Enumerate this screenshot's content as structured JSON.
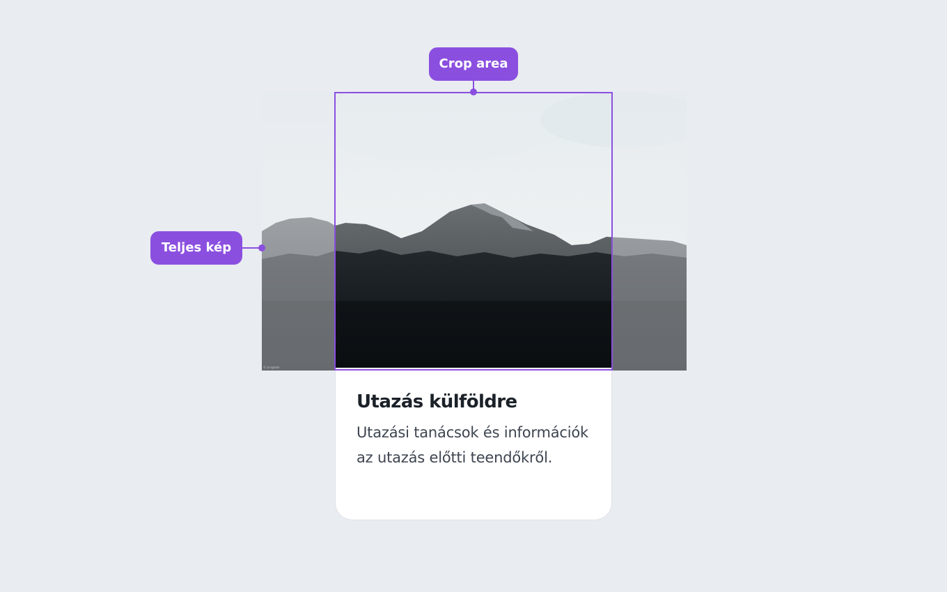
{
  "annotations": {
    "crop_label": "Crop area",
    "full_label": "Teljes kép"
  },
  "card": {
    "title": "Utazás külföldre",
    "description": "Utazási tanácsok és információk az utazás előtti teendőkről."
  },
  "image": {
    "subject": "mountain-landscape",
    "credit": "© Unsplash"
  },
  "colors": {
    "accent": "#8b4fe0",
    "background": "#e9ecf1",
    "card": "#ffffff",
    "title": "#1b2128",
    "text": "#3d4550"
  }
}
